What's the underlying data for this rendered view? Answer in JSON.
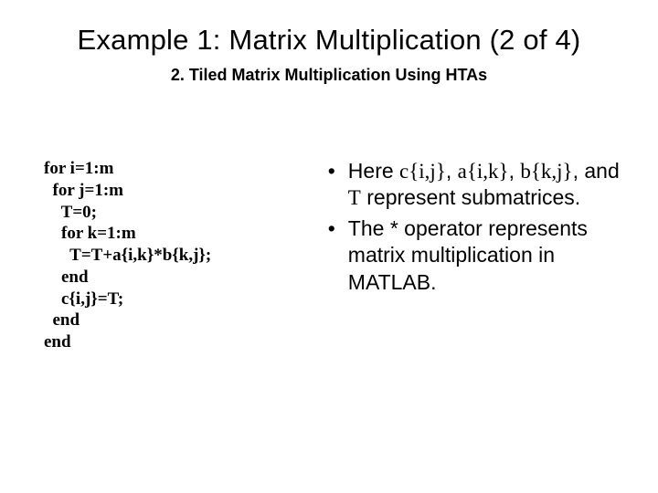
{
  "title": "Example 1: Matrix Multiplication (2 of 4)",
  "subtitle": "2. Tiled Matrix Multiplication Using HTAs",
  "code": "for i=1:m\n  for j=1:m\n    T=0;\n    for k=1:m\n      T=T+a{i,k}*b{k,j};\n    end\n    c{i,j}=T;\n  end\nend",
  "b1": {
    "pre": "Here ",
    "v1": "c{i,j}",
    "s1": ", ",
    "v2": "a{i,k}",
    "s2": ", ",
    "v3": "b{k,j}",
    "s3": ", and ",
    "v4": "T",
    "post": " represent submatrices."
  },
  "b2": "The * operator represents matrix multiplication in MATLAB."
}
